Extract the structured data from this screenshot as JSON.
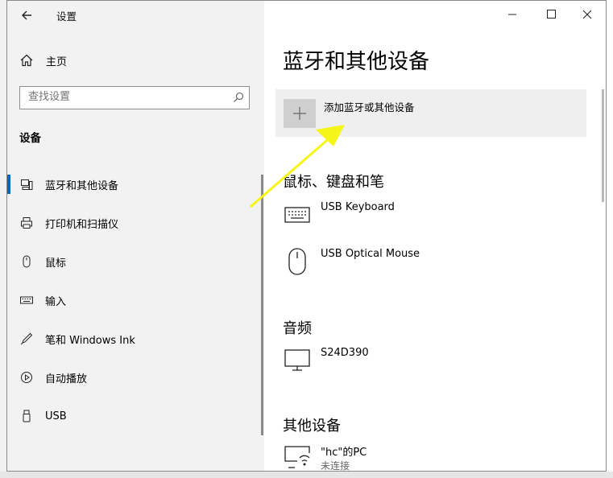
{
  "window": {
    "title": "设置",
    "caption_icons": [
      "minimize-icon",
      "maximize-icon",
      "close-icon"
    ]
  },
  "sidebar": {
    "home_label": "主页",
    "search_placeholder": "查找设置",
    "section_title": "设备",
    "items": [
      {
        "label": "蓝牙和其他设备",
        "icon": "bluetooth-devices-icon",
        "active": true
      },
      {
        "label": "打印机和扫描仪",
        "icon": "printer-icon",
        "active": false
      },
      {
        "label": "鼠标",
        "icon": "mouse-icon",
        "active": false
      },
      {
        "label": "输入",
        "icon": "keyboard-icon",
        "active": false
      },
      {
        "label": "笔和 Windows Ink",
        "icon": "pen-icon",
        "active": false
      },
      {
        "label": "自动播放",
        "icon": "autoplay-icon",
        "active": false
      },
      {
        "label": "USB",
        "icon": "usb-icon",
        "active": false
      }
    ]
  },
  "content": {
    "page_title": "蓝牙和其他设备",
    "add_device_label": "添加蓝牙或其他设备",
    "sections": [
      {
        "title": "鼠标、键盘和笔",
        "devices": [
          {
            "name": "USB Keyboard",
            "icon": "keyboard-icon"
          },
          {
            "name": "USB Optical Mouse",
            "icon": "mouse-icon"
          }
        ]
      },
      {
        "title": "音频",
        "devices": [
          {
            "name": "S24D390",
            "icon": "monitor-icon"
          }
        ]
      },
      {
        "title": "其他设备",
        "devices": [
          {
            "name": "\"hc\"的PC",
            "status": "未连接",
            "icon": "wireless-display-icon"
          }
        ]
      }
    ]
  },
  "colors": {
    "accent": "#0067c0",
    "sidebar_bg": "#f2f2f2",
    "highlight_arrow": "#f5f51a"
  }
}
